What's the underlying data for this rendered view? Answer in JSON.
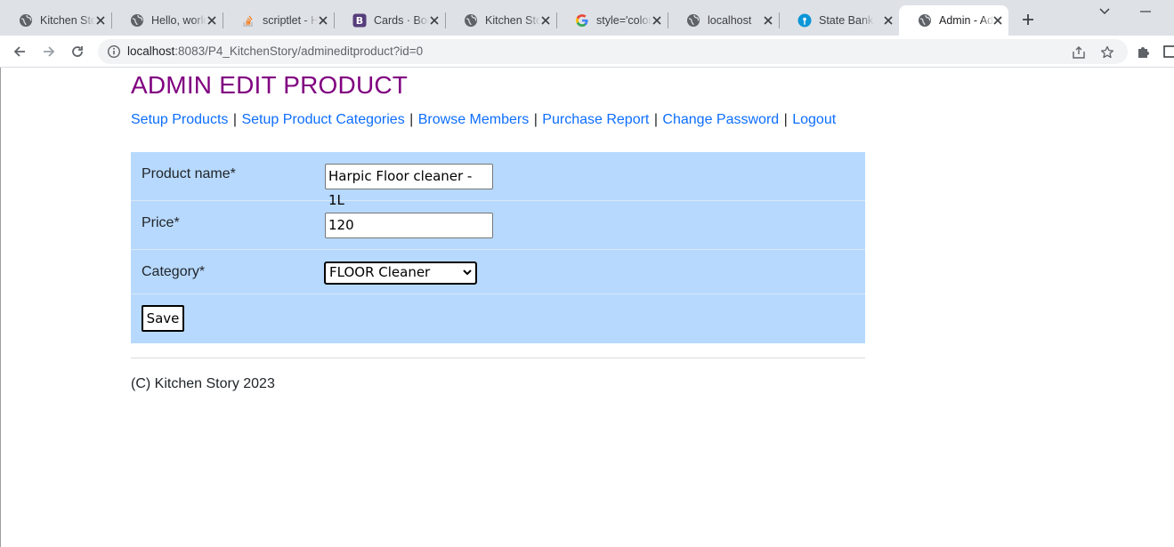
{
  "browser": {
    "tabs": [
      {
        "title": "Kitchen Story",
        "icon": "globe-icon"
      },
      {
        "title": "Hello, world",
        "icon": "globe-icon"
      },
      {
        "title": "scriptlet - H",
        "icon": "stackoverflow-icon"
      },
      {
        "title": "Cards · Boo",
        "icon": "bootstrap-icon"
      },
      {
        "title": "Kitchen Story",
        "icon": "globe-icon"
      },
      {
        "title": "style='color",
        "icon": "google-icon"
      },
      {
        "title": "localhost",
        "icon": "globe-icon"
      },
      {
        "title": "State Bank",
        "icon": "sbi-icon"
      },
      {
        "title": "Admin - Ad",
        "icon": "globe-icon"
      }
    ],
    "url_host": "localhost",
    "url_rest": ":8083/P4_KitchenStory/admineditproduct?id=0",
    "colors": {
      "chrome": "#dee1e6",
      "omnibox": "#f1f3f4"
    }
  },
  "page": {
    "title": "ADMIN EDIT PRODUCT",
    "nav": [
      "Setup Products",
      "Setup Product Categories",
      "Browse Members",
      "Purchase Report",
      "Change Password",
      "Logout"
    ],
    "separator": "|",
    "form": {
      "product_label": "Product name*",
      "product_value": "Harpic Floor cleaner - 1L",
      "price_label": "Price*",
      "price_value": "120",
      "category_label": "Category*",
      "category_selected": "FLOOR Cleaner",
      "save_label": "Save"
    },
    "footer": "(C) Kitchen Story 2023",
    "colors": {
      "title": "#800080",
      "link": "#0d6efd",
      "form_bg": "#b7d9fe"
    }
  }
}
